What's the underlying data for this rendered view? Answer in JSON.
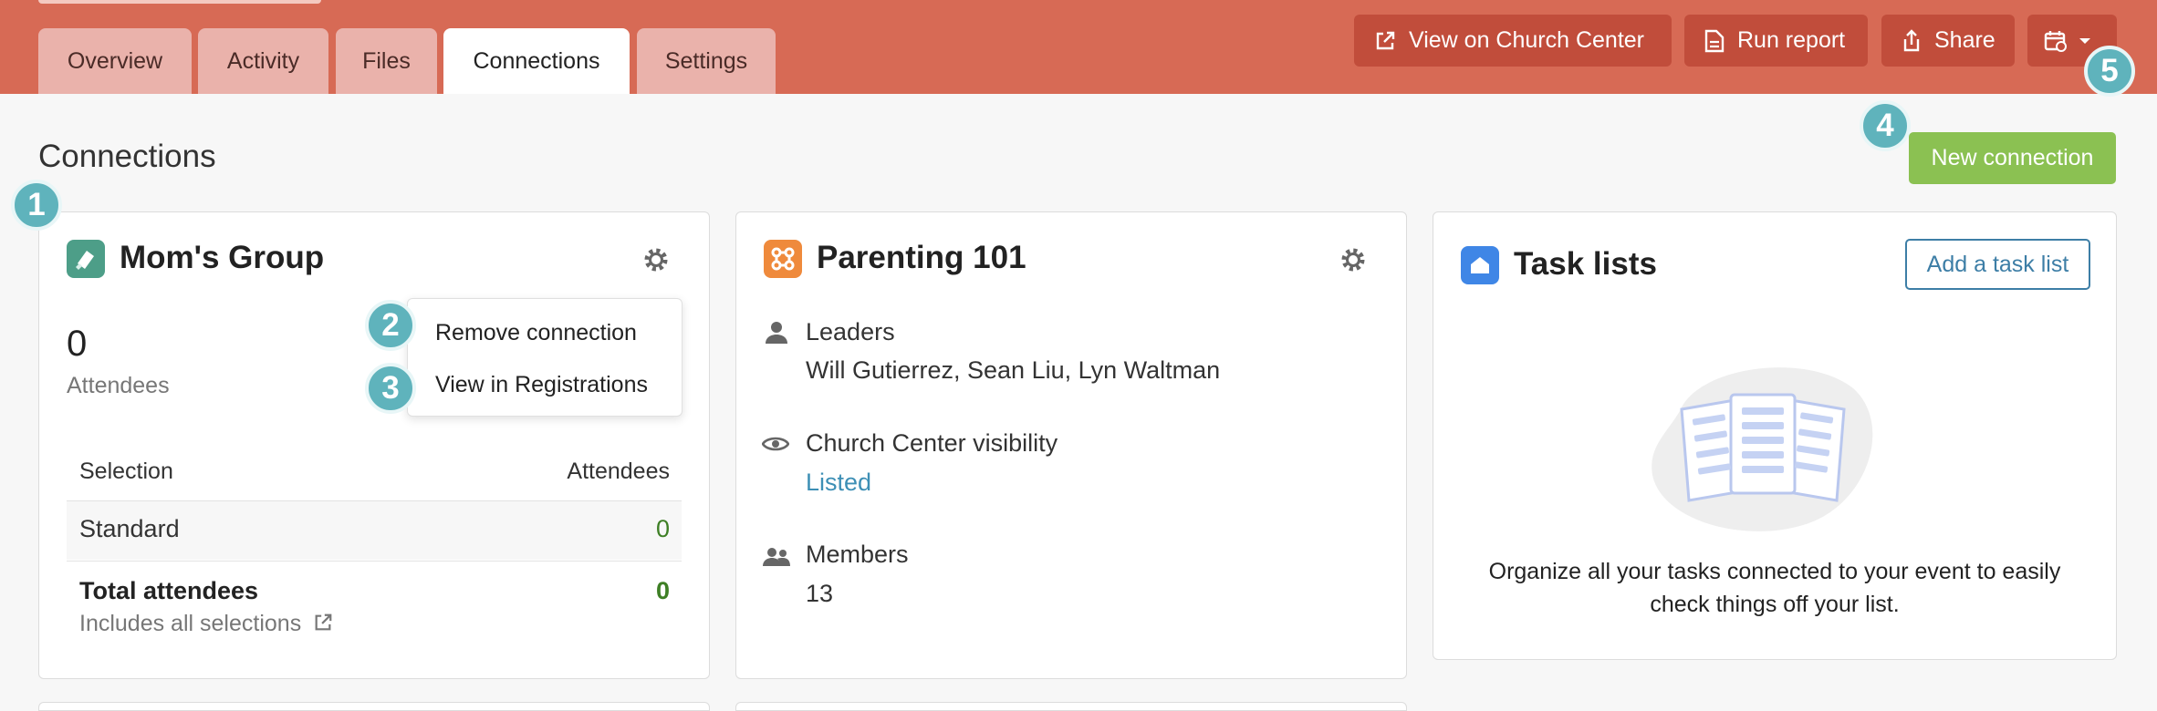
{
  "tabs": [
    "Overview",
    "Activity",
    "Files",
    "Connections",
    "Settings"
  ],
  "active_tab": "Connections",
  "toolbar": {
    "view_church_center": "View on Church Center",
    "run_report": "Run report",
    "share": "Share"
  },
  "page": {
    "title": "Connections",
    "new_connection": "New connection"
  },
  "badges": [
    "1",
    "2",
    "3",
    "4",
    "5"
  ],
  "moms_group": {
    "title": "Mom's Group",
    "count": "0",
    "count_label": "Attendees",
    "col_selection": "Selection",
    "col_attendees": "Attendees",
    "rows": [
      {
        "name": "Standard",
        "value": "0"
      }
    ],
    "total_label": "Total attendees",
    "total_value": "0",
    "includes_text": "Includes all selections"
  },
  "menu": {
    "remove": "Remove connection",
    "view_registrations": "View in Registrations"
  },
  "parenting": {
    "title": "Parenting 101",
    "leaders_label": "Leaders",
    "leaders_value": "Will Gutierrez, Sean Liu, Lyn Waltman",
    "visibility_label": "Church Center visibility",
    "visibility_value": "Listed",
    "members_label": "Members",
    "members_value": "13"
  },
  "tasks": {
    "title": "Task lists",
    "add_button": "Add a task list",
    "description_line1": "Organize all your tasks connected to your event to easily",
    "description_line2": "check things off your list."
  },
  "colors": {
    "header": "#d76a55",
    "header_button": "#c14d3b",
    "green": "#8bc152",
    "badge": "#5fb3bc",
    "link": "#3d7ea6",
    "success": "#3e7f25"
  }
}
